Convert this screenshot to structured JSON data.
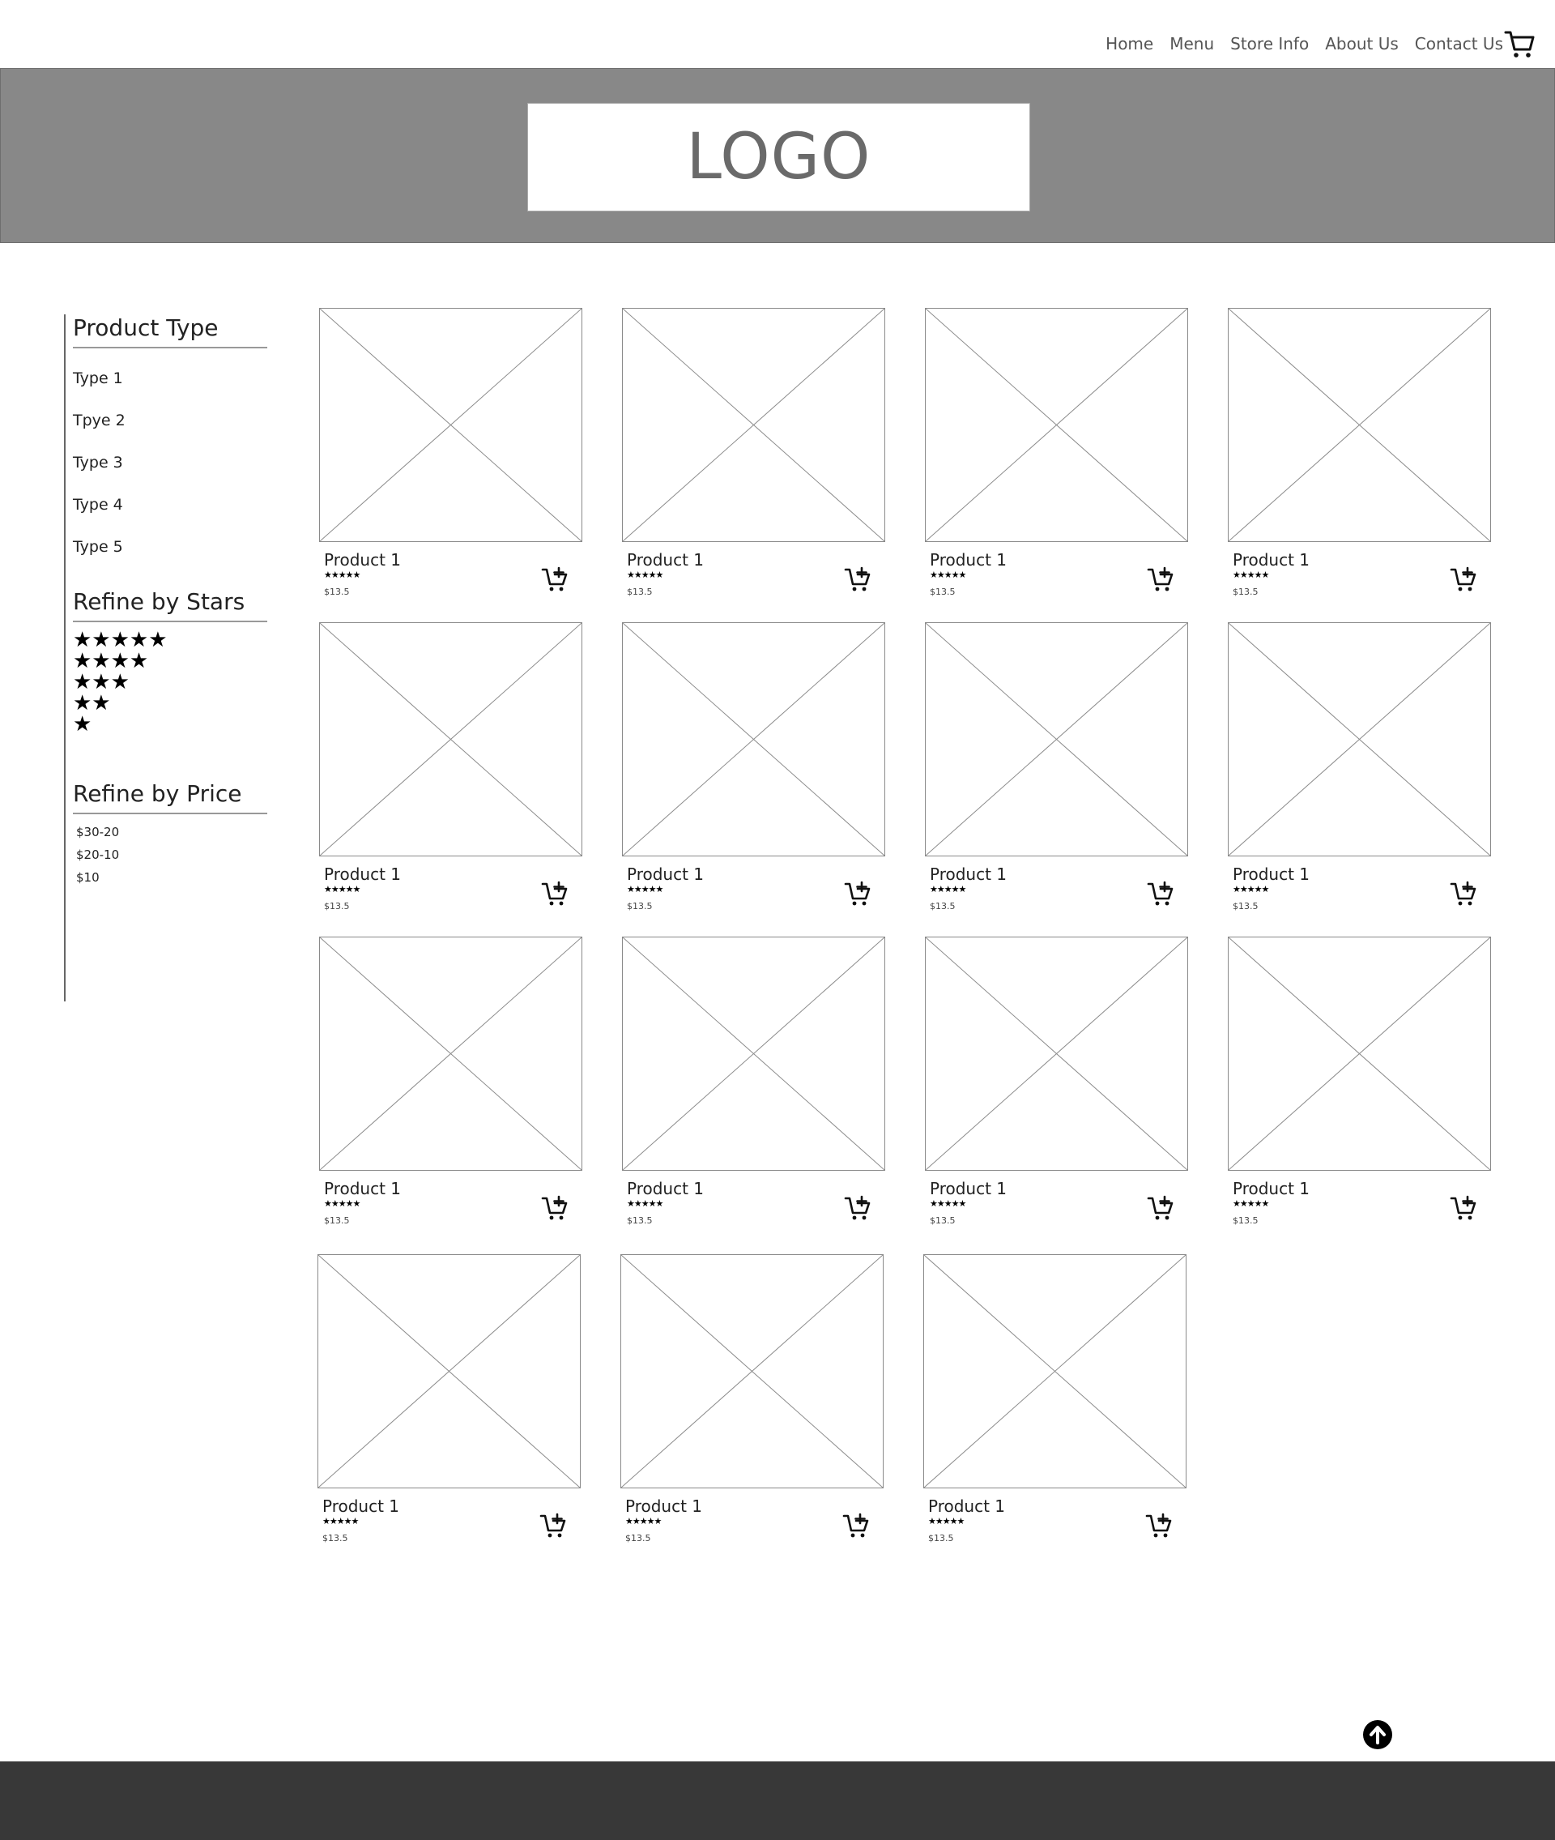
{
  "nav": {
    "links": [
      "Home",
      "Menu",
      "Store Info",
      "About Us",
      "Contact Us"
    ],
    "cart_icon": "shopping-cart-icon"
  },
  "banner": {
    "logo_text": "LOGO",
    "background": "#888888"
  },
  "sidebar": {
    "product_type": {
      "title": "Product Type",
      "items": [
        "Type 1",
        "Tpye 2",
        "Type 3",
        "Type 4",
        "Type 5"
      ]
    },
    "stars": {
      "title": "Refine by Stars",
      "options": [
        5,
        4,
        3,
        2,
        1
      ]
    },
    "price": {
      "title": "Refine by Price",
      "items": [
        "$30-20",
        "$20-10",
        "$10"
      ]
    }
  },
  "products": [
    {
      "name": "Product 1",
      "stars": "★★★★★",
      "price": "$13.5"
    },
    {
      "name": "Product 1",
      "stars": "★★★★★",
      "price": "$13.5"
    },
    {
      "name": "Product 1",
      "stars": "★★★★★",
      "price": "$13.5"
    },
    {
      "name": "Product 1",
      "stars": "★★★★★",
      "price": "$13.5"
    },
    {
      "name": "Product 1",
      "stars": "★★★★★",
      "price": "$13.5"
    },
    {
      "name": "Product 1",
      "stars": "★★★★★",
      "price": "$13.5"
    },
    {
      "name": "Product 1",
      "stars": "★★★★★",
      "price": "$13.5"
    },
    {
      "name": "Product 1",
      "stars": "★★★★★",
      "price": "$13.5"
    },
    {
      "name": "Product 1",
      "stars": "★★★★★",
      "price": "$13.5"
    },
    {
      "name": "Product 1",
      "stars": "★★★★★",
      "price": "$13.5"
    },
    {
      "name": "Product 1",
      "stars": "★★★★★",
      "price": "$13.5"
    },
    {
      "name": "Product 1",
      "stars": "★★★★★",
      "price": "$13.5"
    },
    {
      "name": "Product 1",
      "stars": "★★★★★",
      "price": "$13.5"
    },
    {
      "name": "Product 1",
      "stars": "★★★★★",
      "price": "$13.5"
    },
    {
      "name": "Product 1",
      "stars": "★★★★★",
      "price": "$13.5"
    }
  ],
  "icons": {
    "add_to_cart": "add-to-cart-icon",
    "back_to_top": "arrow-up-circle-icon"
  },
  "colors": {
    "banner": "#888888",
    "footer": "#383838",
    "border": "#8a8a8a"
  }
}
